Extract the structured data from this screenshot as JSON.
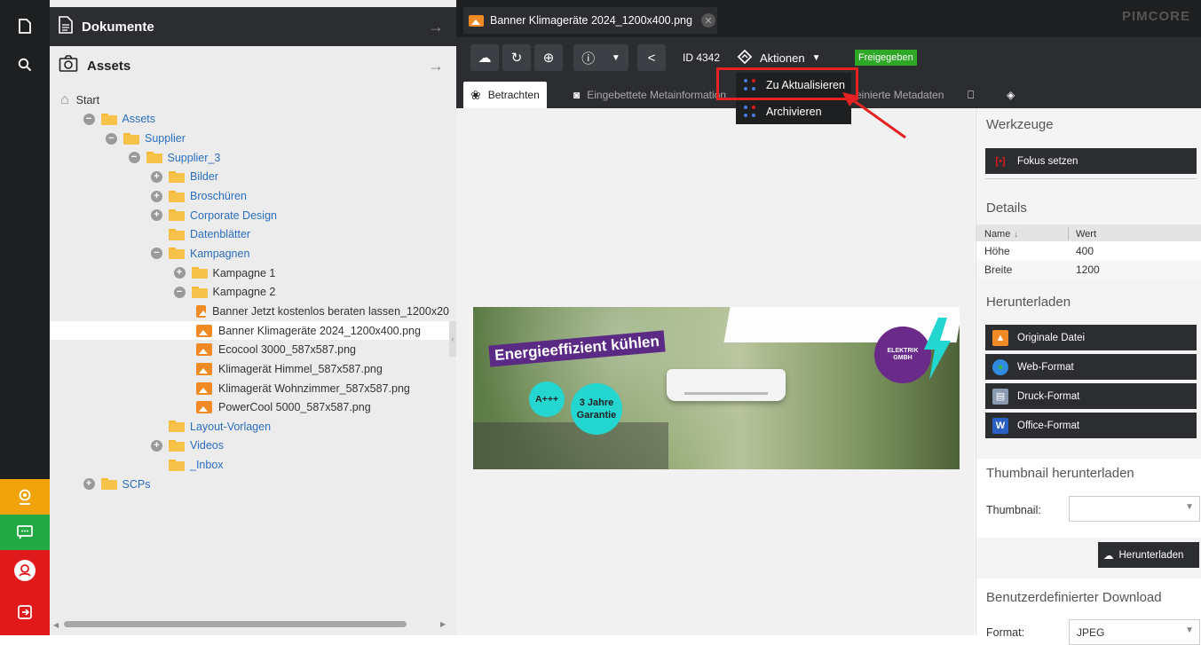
{
  "rail": {
    "icons": [
      "document-icon",
      "search-icon",
      "user-badge-icon",
      "chat-icon",
      "profile-icon",
      "logout-icon"
    ],
    "colors": {
      "badge": "#f0a30a",
      "chat": "#22a845",
      "profile": "#e0191b",
      "logout": "#e0191b"
    }
  },
  "tree_panel": {
    "documents_title": "Dokumente",
    "assets_title": "Assets",
    "items": [
      {
        "label": "Start",
        "level": 0,
        "kind": "home",
        "toggle": ""
      },
      {
        "label": "Assets",
        "level": 1,
        "kind": "folder",
        "toggle": "−"
      },
      {
        "label": "Supplier",
        "level": 2,
        "kind": "folder",
        "toggle": "−"
      },
      {
        "label": "Supplier_3",
        "level": 3,
        "kind": "folder",
        "toggle": "−"
      },
      {
        "label": "Bilder",
        "level": 4,
        "kind": "folder",
        "toggle": "+"
      },
      {
        "label": "Broschüren",
        "level": 4,
        "kind": "folder",
        "toggle": "+"
      },
      {
        "label": "Corporate Design",
        "level": 4,
        "kind": "folder",
        "toggle": "+"
      },
      {
        "label": "Datenblätter",
        "level": 4,
        "kind": "folder",
        "toggle": ""
      },
      {
        "label": "Kampagnen",
        "level": 4,
        "kind": "folder",
        "toggle": "−"
      },
      {
        "label": "Kampagne 1",
        "level": 5,
        "kind": "folder",
        "toggle": "+"
      },
      {
        "label": "Kampagne 2",
        "level": 5,
        "kind": "folder",
        "toggle": "−"
      },
      {
        "label": "Banner Jetzt kostenlos beraten lassen_1200x20",
        "level": 6,
        "kind": "image",
        "toggle": ""
      },
      {
        "label": "Banner Klimageräte 2024_1200x400.png",
        "level": 6,
        "kind": "image",
        "toggle": "",
        "selected": true
      },
      {
        "label": "Ecocool 3000_587x587.png",
        "level": 6,
        "kind": "image",
        "toggle": ""
      },
      {
        "label": "Klimagerät Himmel_587x587.png",
        "level": 6,
        "kind": "image",
        "toggle": ""
      },
      {
        "label": "Klimagerät Wohnzimmer_587x587.png",
        "level": 6,
        "kind": "image",
        "toggle": ""
      },
      {
        "label": "PowerCool 5000_587x587.png",
        "level": 6,
        "kind": "image",
        "toggle": ""
      },
      {
        "label": "Layout-Vorlagen",
        "level": 4,
        "kind": "folder",
        "toggle": ""
      },
      {
        "label": "Videos",
        "level": 4,
        "kind": "folder",
        "toggle": "+"
      },
      {
        "label": "_Inbox",
        "level": 4,
        "kind": "folder",
        "toggle": ""
      },
      {
        "label": "SCPs",
        "level": 1,
        "kind": "folder",
        "toggle": "+"
      }
    ]
  },
  "tab": {
    "title": "Banner Klimageräte 2024_1200x400.png",
    "brand": "PIMCORE"
  },
  "toolbar": {
    "id_label": "ID 4342",
    "actions_label": "Aktionen",
    "status_badge": "Freigegeben",
    "status_color": "#2fa827"
  },
  "subtabs": [
    "Betrachten",
    "Eingebettete Metainformation",
    "einierte Metadaten"
  ],
  "menu": {
    "items": [
      "Zu Aktualisieren",
      "Archivieren"
    ],
    "highlight_color": "#e52121"
  },
  "banner": {
    "headline": "Energieeffizient kühlen",
    "badge1": "A+++",
    "badge2_line1": "3 Jahre",
    "badge2_line2": "Garantie",
    "brand_line1": "ELEKTRIK",
    "brand_line2": "GMBH"
  },
  "sidebar": {
    "tools_title": "Werkzeuge",
    "focus_button": "Fokus setzen",
    "details_title": "Details",
    "details_headers": [
      "Name",
      "Wert"
    ],
    "details_rows": [
      {
        "name": "Höhe",
        "value": "400"
      },
      {
        "name": "Breite",
        "value": "1200"
      }
    ],
    "download_title": "Herunterladen",
    "download_buttons": [
      "Originale Datei",
      "Web-Format",
      "Druck-Format",
      "Office-Format"
    ],
    "thumb_title": "Thumbnail herunterladen",
    "thumb_label": "Thumbnail:",
    "thumb_button": "Herunterladen",
    "custom_title": "Benutzerdefinierter Download",
    "format_label": "Format:",
    "format_value": "JPEG"
  }
}
